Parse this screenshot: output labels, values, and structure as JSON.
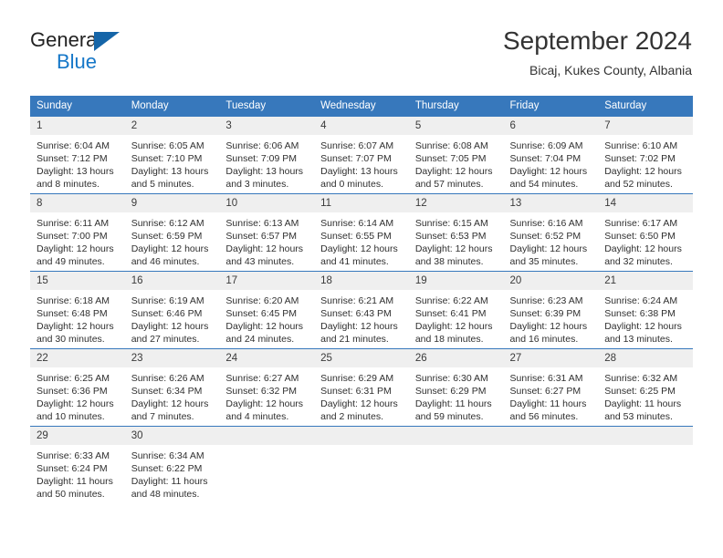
{
  "brand": {
    "name_part1": "General",
    "name_part2": "Blue",
    "triangle_color": "#1565a8",
    "blue_color": "#1577c8"
  },
  "header": {
    "title": "September 2024",
    "location": "Bicaj, Kukes County, Albania"
  },
  "theme": {
    "header_row_bg": "#3778bc",
    "daynum_bg": "#efefef",
    "border_color": "#3778bc",
    "text_color": "#2f2f2f"
  },
  "labels": {
    "sunrise_prefix": "Sunrise: ",
    "sunset_prefix": "Sunset: ",
    "daylight_prefix": "Daylight: "
  },
  "weekdays": [
    "Sunday",
    "Monday",
    "Tuesday",
    "Wednesday",
    "Thursday",
    "Friday",
    "Saturday"
  ],
  "weeks": [
    [
      {
        "day": "1",
        "sunrise": "Sunrise: 6:04 AM",
        "sunset": "Sunset: 7:12 PM",
        "daylight_line1": "Daylight: 13 hours",
        "daylight_line2": "and 8 minutes."
      },
      {
        "day": "2",
        "sunrise": "Sunrise: 6:05 AM",
        "sunset": "Sunset: 7:10 PM",
        "daylight_line1": "Daylight: 13 hours",
        "daylight_line2": "and 5 minutes."
      },
      {
        "day": "3",
        "sunrise": "Sunrise: 6:06 AM",
        "sunset": "Sunset: 7:09 PM",
        "daylight_line1": "Daylight: 13 hours",
        "daylight_line2": "and 3 minutes."
      },
      {
        "day": "4",
        "sunrise": "Sunrise: 6:07 AM",
        "sunset": "Sunset: 7:07 PM",
        "daylight_line1": "Daylight: 13 hours",
        "daylight_line2": "and 0 minutes."
      },
      {
        "day": "5",
        "sunrise": "Sunrise: 6:08 AM",
        "sunset": "Sunset: 7:05 PM",
        "daylight_line1": "Daylight: 12 hours",
        "daylight_line2": "and 57 minutes."
      },
      {
        "day": "6",
        "sunrise": "Sunrise: 6:09 AM",
        "sunset": "Sunset: 7:04 PM",
        "daylight_line1": "Daylight: 12 hours",
        "daylight_line2": "and 54 minutes."
      },
      {
        "day": "7",
        "sunrise": "Sunrise: 6:10 AM",
        "sunset": "Sunset: 7:02 PM",
        "daylight_line1": "Daylight: 12 hours",
        "daylight_line2": "and 52 minutes."
      }
    ],
    [
      {
        "day": "8",
        "sunrise": "Sunrise: 6:11 AM",
        "sunset": "Sunset: 7:00 PM",
        "daylight_line1": "Daylight: 12 hours",
        "daylight_line2": "and 49 minutes."
      },
      {
        "day": "9",
        "sunrise": "Sunrise: 6:12 AM",
        "sunset": "Sunset: 6:59 PM",
        "daylight_line1": "Daylight: 12 hours",
        "daylight_line2": "and 46 minutes."
      },
      {
        "day": "10",
        "sunrise": "Sunrise: 6:13 AM",
        "sunset": "Sunset: 6:57 PM",
        "daylight_line1": "Daylight: 12 hours",
        "daylight_line2": "and 43 minutes."
      },
      {
        "day": "11",
        "sunrise": "Sunrise: 6:14 AM",
        "sunset": "Sunset: 6:55 PM",
        "daylight_line1": "Daylight: 12 hours",
        "daylight_line2": "and 41 minutes."
      },
      {
        "day": "12",
        "sunrise": "Sunrise: 6:15 AM",
        "sunset": "Sunset: 6:53 PM",
        "daylight_line1": "Daylight: 12 hours",
        "daylight_line2": "and 38 minutes."
      },
      {
        "day": "13",
        "sunrise": "Sunrise: 6:16 AM",
        "sunset": "Sunset: 6:52 PM",
        "daylight_line1": "Daylight: 12 hours",
        "daylight_line2": "and 35 minutes."
      },
      {
        "day": "14",
        "sunrise": "Sunrise: 6:17 AM",
        "sunset": "Sunset: 6:50 PM",
        "daylight_line1": "Daylight: 12 hours",
        "daylight_line2": "and 32 minutes."
      }
    ],
    [
      {
        "day": "15",
        "sunrise": "Sunrise: 6:18 AM",
        "sunset": "Sunset: 6:48 PM",
        "daylight_line1": "Daylight: 12 hours",
        "daylight_line2": "and 30 minutes."
      },
      {
        "day": "16",
        "sunrise": "Sunrise: 6:19 AM",
        "sunset": "Sunset: 6:46 PM",
        "daylight_line1": "Daylight: 12 hours",
        "daylight_line2": "and 27 minutes."
      },
      {
        "day": "17",
        "sunrise": "Sunrise: 6:20 AM",
        "sunset": "Sunset: 6:45 PM",
        "daylight_line1": "Daylight: 12 hours",
        "daylight_line2": "and 24 minutes."
      },
      {
        "day": "18",
        "sunrise": "Sunrise: 6:21 AM",
        "sunset": "Sunset: 6:43 PM",
        "daylight_line1": "Daylight: 12 hours",
        "daylight_line2": "and 21 minutes."
      },
      {
        "day": "19",
        "sunrise": "Sunrise: 6:22 AM",
        "sunset": "Sunset: 6:41 PM",
        "daylight_line1": "Daylight: 12 hours",
        "daylight_line2": "and 18 minutes."
      },
      {
        "day": "20",
        "sunrise": "Sunrise: 6:23 AM",
        "sunset": "Sunset: 6:39 PM",
        "daylight_line1": "Daylight: 12 hours",
        "daylight_line2": "and 16 minutes."
      },
      {
        "day": "21",
        "sunrise": "Sunrise: 6:24 AM",
        "sunset": "Sunset: 6:38 PM",
        "daylight_line1": "Daylight: 12 hours",
        "daylight_line2": "and 13 minutes."
      }
    ],
    [
      {
        "day": "22",
        "sunrise": "Sunrise: 6:25 AM",
        "sunset": "Sunset: 6:36 PM",
        "daylight_line1": "Daylight: 12 hours",
        "daylight_line2": "and 10 minutes."
      },
      {
        "day": "23",
        "sunrise": "Sunrise: 6:26 AM",
        "sunset": "Sunset: 6:34 PM",
        "daylight_line1": "Daylight: 12 hours",
        "daylight_line2": "and 7 minutes."
      },
      {
        "day": "24",
        "sunrise": "Sunrise: 6:27 AM",
        "sunset": "Sunset: 6:32 PM",
        "daylight_line1": "Daylight: 12 hours",
        "daylight_line2": "and 4 minutes."
      },
      {
        "day": "25",
        "sunrise": "Sunrise: 6:29 AM",
        "sunset": "Sunset: 6:31 PM",
        "daylight_line1": "Daylight: 12 hours",
        "daylight_line2": "and 2 minutes."
      },
      {
        "day": "26",
        "sunrise": "Sunrise: 6:30 AM",
        "sunset": "Sunset: 6:29 PM",
        "daylight_line1": "Daylight: 11 hours",
        "daylight_line2": "and 59 minutes."
      },
      {
        "day": "27",
        "sunrise": "Sunrise: 6:31 AM",
        "sunset": "Sunset: 6:27 PM",
        "daylight_line1": "Daylight: 11 hours",
        "daylight_line2": "and 56 minutes."
      },
      {
        "day": "28",
        "sunrise": "Sunrise: 6:32 AM",
        "sunset": "Sunset: 6:25 PM",
        "daylight_line1": "Daylight: 11 hours",
        "daylight_line2": "and 53 minutes."
      }
    ],
    [
      {
        "day": "29",
        "sunrise": "Sunrise: 6:33 AM",
        "sunset": "Sunset: 6:24 PM",
        "daylight_line1": "Daylight: 11 hours",
        "daylight_line2": "and 50 minutes."
      },
      {
        "day": "30",
        "sunrise": "Sunrise: 6:34 AM",
        "sunset": "Sunset: 6:22 PM",
        "daylight_line1": "Daylight: 11 hours",
        "daylight_line2": "and 48 minutes."
      },
      {
        "day": "",
        "sunrise": "",
        "sunset": "",
        "daylight_line1": "",
        "daylight_line2": ""
      },
      {
        "day": "",
        "sunrise": "",
        "sunset": "",
        "daylight_line1": "",
        "daylight_line2": ""
      },
      {
        "day": "",
        "sunrise": "",
        "sunset": "",
        "daylight_line1": "",
        "daylight_line2": ""
      },
      {
        "day": "",
        "sunrise": "",
        "sunset": "",
        "daylight_line1": "",
        "daylight_line2": ""
      },
      {
        "day": "",
        "sunrise": "",
        "sunset": "",
        "daylight_line1": "",
        "daylight_line2": ""
      }
    ]
  ]
}
